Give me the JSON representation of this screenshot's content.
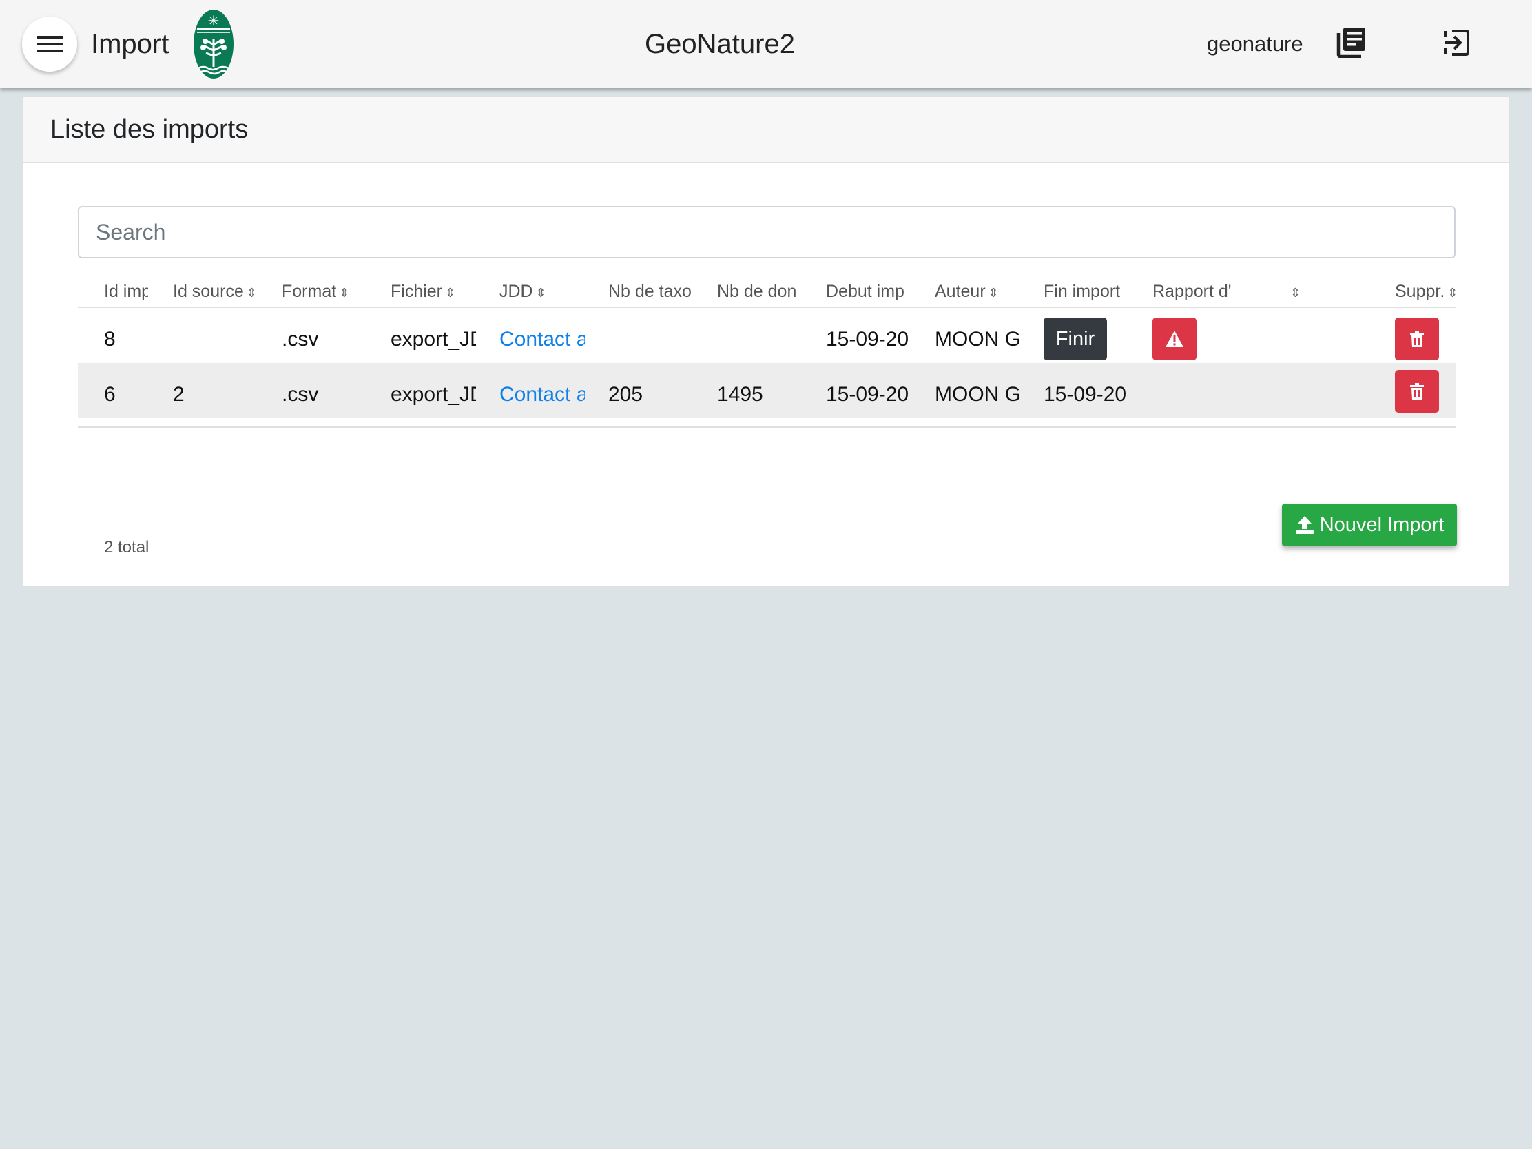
{
  "header": {
    "app_title": "Import",
    "center_title": "GeoNature2",
    "username": "geonature",
    "icons": {
      "menu": "menu-icon",
      "logo": "logo-icon",
      "docs": "documentation-icon",
      "logout": "logout-icon"
    },
    "colors": {
      "logo": "#0a7a55"
    }
  },
  "card": {
    "title": "Liste des imports",
    "search_placeholder": "Search",
    "columns": [
      {
        "label": "Id imp",
        "sortable": false
      },
      {
        "label": "Id source",
        "sortable": true
      },
      {
        "label": "Format",
        "sortable": true
      },
      {
        "label": "Fichier",
        "sortable": true
      },
      {
        "label": "JDD",
        "sortable": true
      },
      {
        "label": "Nb de taxo",
        "sortable": false
      },
      {
        "label": "Nb de don",
        "sortable": false
      },
      {
        "label": "Debut imp",
        "sortable": false
      },
      {
        "label": "Auteur",
        "sortable": true
      },
      {
        "label": "Fin import",
        "sortable": false
      },
      {
        "label": "Rapport d'",
        "sortable": false
      },
      {
        "label": "",
        "sortable": true
      },
      {
        "label": "Suppr.",
        "sortable": true
      }
    ],
    "rows": [
      {
        "id": "8",
        "id_source": "",
        "format": ".csv",
        "fichier": "export_JD",
        "jdd": "Contact a",
        "nb_taxons": "",
        "nb_donnees": "",
        "debut": "15-09-20",
        "auteur": "MOON Ge",
        "fin": "",
        "finir_label": "Finir",
        "has_report": true,
        "report_icon": "warning-icon",
        "delete_icon": "trash-icon"
      },
      {
        "id": "6",
        "id_source": "2",
        "format": ".csv",
        "fichier": "export_JD",
        "jdd": "Contact a",
        "nb_taxons": "205",
        "nb_donnees": "1495",
        "debut": "15-09-20",
        "auteur": "MOON Ge",
        "fin": "15-09-20",
        "finir_label": "",
        "has_report": false,
        "report_icon": "",
        "delete_icon": "trash-icon"
      }
    ],
    "total_text": "2 total",
    "new_import_label": "Nouvel Import",
    "new_import_icon": "upload-icon",
    "colors": {
      "link": "#1080e8",
      "danger": "#dc3545",
      "success": "#28a745",
      "dark": "#343a40"
    }
  }
}
